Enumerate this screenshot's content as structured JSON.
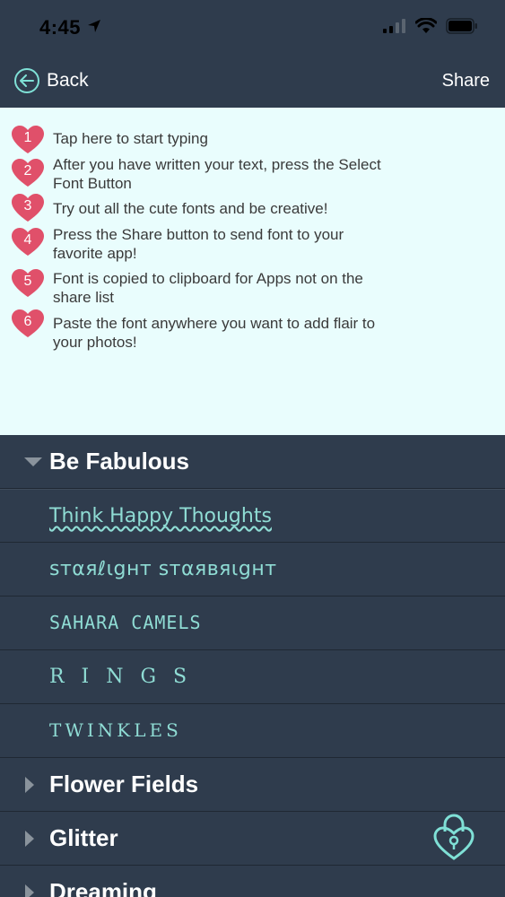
{
  "status_bar": {
    "time": "4:45"
  },
  "nav": {
    "back_label": "Back",
    "share_label": "Share"
  },
  "instructions": [
    {
      "num": "1",
      "text": "Tap here to start typing"
    },
    {
      "num": "2",
      "text": "After you have written your text, press the Select Font Button"
    },
    {
      "num": "3",
      "text": "Try out all the cute fonts and be creative!"
    },
    {
      "num": "4",
      "text": "Press the Share button to send font to your favorite app!"
    },
    {
      "num": "5",
      "text": "Font is copied to clipboard for Apps not on the share list"
    },
    {
      "num": "6",
      "text": "Paste the font anywhere you want to add flair to your photos!"
    }
  ],
  "sections": [
    {
      "title": "Be Fabulous",
      "expanded": true,
      "fonts": [
        "Think Happy Thoughts",
        "sтαяℓιgнт sтαявяιgнт",
        "SAHARA CAMELS",
        "R I N G S",
        "TWINKLES"
      ]
    },
    {
      "title": "Flower Fields",
      "expanded": false
    },
    {
      "title": "Glitter",
      "expanded": false
    },
    {
      "title": "Dreaming",
      "expanded": false
    }
  ],
  "colors": {
    "background": "#2f3c4d",
    "instructions_bg": "#e9fdfd",
    "accent": "#7fe0d6",
    "heart": "#e0506a"
  },
  "icons": {
    "back": "back-arrow-circle-icon",
    "lock": "heart-lock-icon",
    "location": "location-arrow-icon"
  }
}
